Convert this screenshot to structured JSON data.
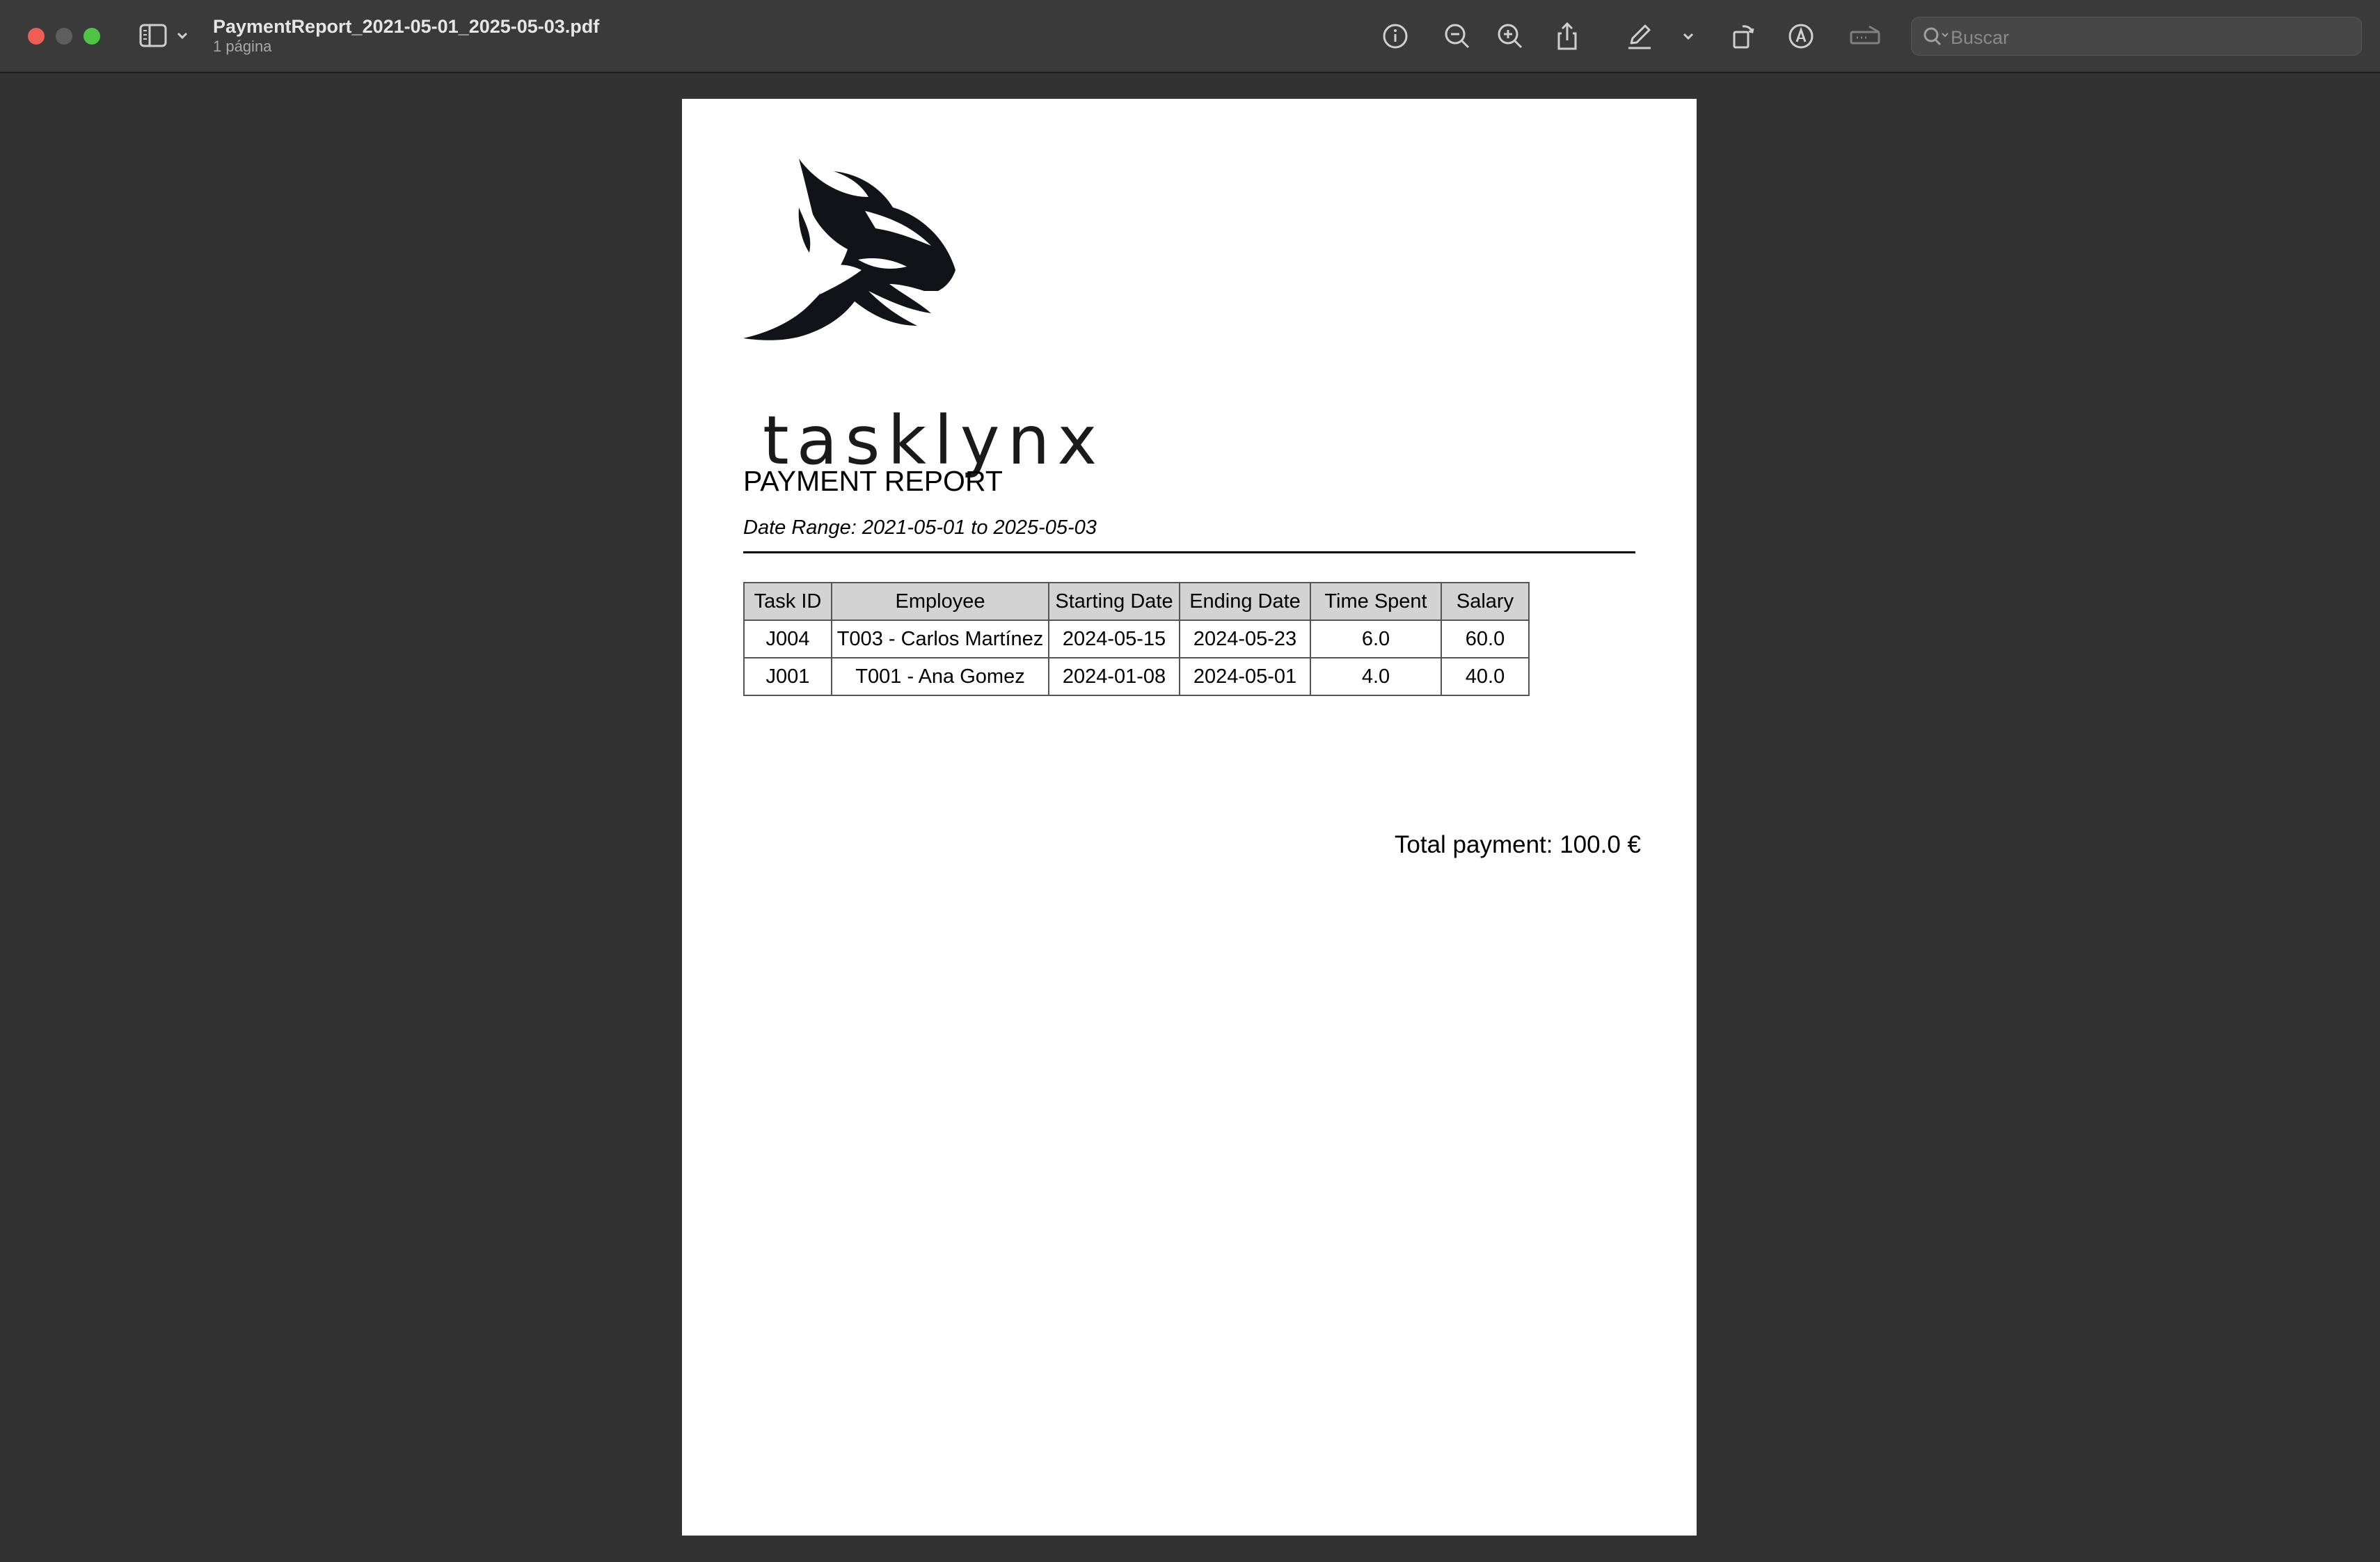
{
  "window": {
    "title": "PaymentReport_2021-05-01_2025-05-03.pdf",
    "subtitle": "1 página"
  },
  "toolbar": {
    "icons": [
      "info-icon",
      "zoom-out-icon",
      "zoom-in-icon",
      "share-icon",
      "markup-pen-icon",
      "chevron-down-icon",
      "rotate-icon",
      "annotate-icon",
      "signature-icon"
    ],
    "search_placeholder": "Buscar"
  },
  "document": {
    "logo_text": "tasklynx",
    "heading": "PAYMENT REPORT",
    "date_range": "Date Range: 2021-05-01 to 2025-05-03",
    "table": {
      "headers": [
        "Task ID",
        "Employee",
        "Starting Date",
        "Ending Date",
        "Time Spent",
        "Salary"
      ],
      "rows": [
        [
          "J004",
          "T003 - Carlos Martínez",
          "2024-05-15",
          "2024-05-23",
          "6.0",
          "60.0"
        ],
        [
          "J001",
          "T001 - Ana Gomez",
          "2024-01-08",
          "2024-05-01",
          "4.0",
          "40.0"
        ]
      ]
    },
    "total": "Total payment: 100.0 €"
  },
  "colors": {
    "toolbar_bg": "#3a3a3a",
    "window_bg": "#323232",
    "page_bg": "#ffffff",
    "table_header_bg": "#d3d3d3",
    "close": "#ee5e57",
    "maximize": "#4fc545"
  }
}
